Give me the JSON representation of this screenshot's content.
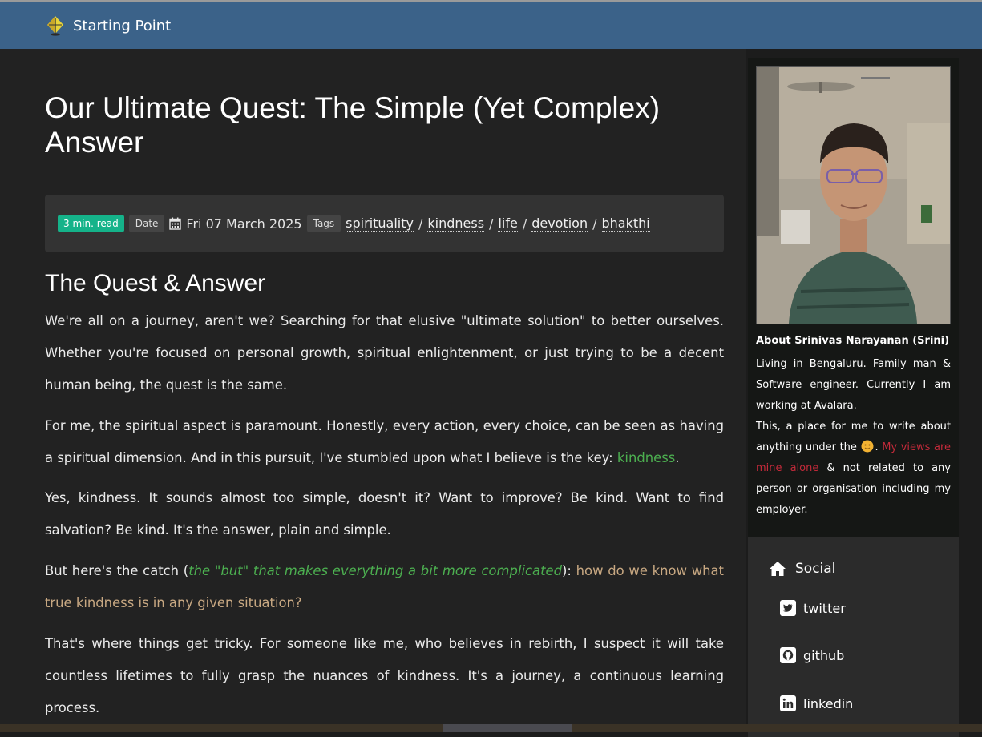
{
  "navbar": {
    "brand": "Starting Point"
  },
  "post": {
    "title": "Our Ultimate Quest: The Simple (Yet Complex) Answer",
    "meta": {
      "read_time": "3 min. read",
      "date_label": "Date",
      "date": "Fri 07 March 2025",
      "tags_label": "Tags",
      "tags": [
        "spirituality",
        "kindness",
        "life",
        "devotion",
        "bhakthi"
      ],
      "separator": "/"
    },
    "section_heading": "The Quest & Answer",
    "p1": "We're all on a journey, aren't we? Searching for that elusive \"ultimate solution\" to better ourselves. Whether you're focused on personal growth, spiritual enlightenment, or just trying to be a decent human being, the quest is the same.",
    "p2_text": "For me, the spiritual aspect is paramount. Honestly, every action, every choice, can be seen as having a spiritual dimension. And in this pursuit, I've stumbled upon what I believe is the key: ",
    "p2_link": "kindness",
    "p2_end": ".",
    "p3": "Yes, kindness. It sounds almost too simple, doesn't it? Want to improve? Be kind. Want to find salvation? Be kind. It's the answer, plain and simple.",
    "p4_start": "But here's the catch (",
    "p4_italic": "the \"but\" that makes everything a bit more complicated",
    "p4_mid": "): ",
    "p4_question": "how do we know what true kindness is in any given situation?",
    "p5": "That's where things get tricky. For someone like me, who believes in rebirth, I suspect it will take countless lifetimes to fully grasp the nuances of kindness. It's a journey, a continuous learning process."
  },
  "sidebar": {
    "about_title": "About Srinivas Narayanan (Srini)",
    "about_text1": "Living in Bengaluru. Family man & Software engineer. Currently I am working at Avalara.",
    "about_text2": "This, a place for me to write about anything under the ",
    "about_red": "My views are mine alone",
    "about_text3": " & not related to any person or organisation including my employer.",
    "social_title": "Social",
    "social_links": [
      "twitter",
      "github",
      "linkedin"
    ],
    "icons": [
      "home-icon",
      "twitter-icon",
      "github-icon",
      "linkedin-icon",
      "sun-emoji"
    ]
  },
  "colors": {
    "navbar": "#3b6289",
    "read_badge": "#15b38a",
    "link_green": "#4caf50",
    "question_tan": "#c8a882",
    "red_text": "#c42a3a"
  }
}
